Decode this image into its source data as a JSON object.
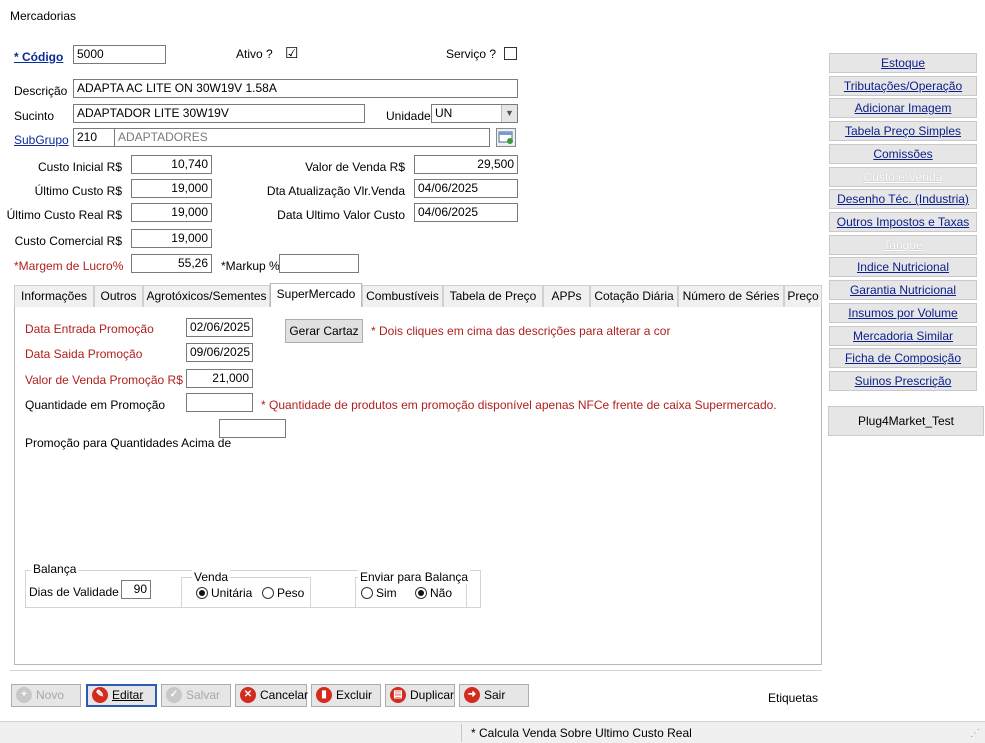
{
  "window": {
    "title": "Mercadorias"
  },
  "form": {
    "codigo_label": "* Código",
    "codigo": "5000",
    "ativo_label": "Ativo ?",
    "ativo_checked": "☑",
    "servico_label": "Serviço ?",
    "descricao_label": "Descrição",
    "descricao": "ADAPTA AC LITE ON 30W19V 1.58A",
    "sucinto_label": "Sucinto",
    "sucinto": "ADAPTADOR LITE 30W19V",
    "unidade_label": "Unidade",
    "unidade": "UN",
    "subgrupo_label": "SubGrupo",
    "subgrupo_code": "210",
    "subgrupo_name": "ADAPTADORES",
    "custo_inicial_label": "Custo Inicial R$",
    "custo_inicial": "10,740",
    "ultimo_custo_label": "Último Custo R$",
    "ultimo_custo": "19,000",
    "ultimo_custo_real_label": "Último Custo Real R$",
    "ultimo_custo_real": "19,000",
    "custo_comercial_label": "Custo Comercial R$",
    "custo_comercial": "19,000",
    "margem_label": "*Margem de Lucro%",
    "margem": "55,26",
    "markup_label": "*Markup %",
    "markup": "",
    "valor_venda_label": "Valor de Venda R$",
    "valor_venda": "29,500",
    "dta_atualizacao_label": "Dta Atualização Vlr.Venda",
    "dta_atualizacao": "04/06/2025",
    "data_ultimo_custo_label": "Data Ultimo Valor Custo",
    "data_ultimo_custo": "04/06/2025"
  },
  "tabs": [
    {
      "label": "Informações"
    },
    {
      "label": "Outros"
    },
    {
      "label": "Agrotóxicos/Sementes"
    },
    {
      "label": "SuperMercado"
    },
    {
      "label": "Combustíveis"
    },
    {
      "label": "Tabela de Preço"
    },
    {
      "label": "APPs"
    },
    {
      "label": "Cotação Diária"
    },
    {
      "label": "Número de Séries"
    },
    {
      "label": "Preço"
    }
  ],
  "supermercado": {
    "data_entrada_label": "Data Entrada Promoção",
    "data_entrada": "02/06/2025",
    "data_saida_label": "Data Saida Promoção",
    "data_saida": "09/06/2025",
    "valor_promo_label": "Valor de Venda  Promoção R$",
    "valor_promo": "21,000",
    "qtd_promo_label": "Quantidade em Promoção",
    "qtd_promo": "",
    "qtd_acima_label": "Promoção para Quantidades Acima de",
    "qtd_acima": "",
    "gerar_cartaz": "Gerar Cartaz",
    "hint_cor": "* Dois cliques em cima das descrições para alterar a cor",
    "hint_qtd": "* Quantidade de produtos em promoção disponível apenas NFCe frente de caixa Supermercado.",
    "balanca_title": "Balança",
    "dias_validade_label": "Dias de Validade",
    "dias_validade": "90",
    "venda_title": "Venda",
    "venda_unitaria": "Unitária",
    "venda_peso": "Peso",
    "enviar_title": "Enviar para Balança",
    "enviar_sim": "Sim",
    "enviar_nao": "Não"
  },
  "sidebar": {
    "items": [
      {
        "label": "Estoque",
        "enabled": true
      },
      {
        "label": "Tributações/Operação",
        "enabled": true
      },
      {
        "label": "Adicionar Imagem",
        "enabled": true
      },
      {
        "label": "Tabela Preço Simples",
        "enabled": true
      },
      {
        "label": "Comissões",
        "enabled": true
      },
      {
        "label": "Custo e Venda",
        "enabled": false
      },
      {
        "label": "Desenho Téc. (Industria)",
        "enabled": true
      },
      {
        "label": "Outros Impostos e Taxas",
        "enabled": true
      },
      {
        "label": "Tanque",
        "enabled": false
      },
      {
        "label": "Indice Nutricional",
        "enabled": true
      },
      {
        "label": "Garantia Nutricional",
        "enabled": true
      },
      {
        "label": "Insumos por Volume",
        "enabled": true
      },
      {
        "label": "Mercadoria Similar",
        "enabled": true
      },
      {
        "label": "Ficha de Composição",
        "enabled": true
      },
      {
        "label": "Suinos Prescrição",
        "enabled": true
      }
    ],
    "plug_label": "Plug4Market_Test"
  },
  "toolbar": {
    "novo": "Novo",
    "editar": "Editar",
    "salvar": "Salvar",
    "cancelar": "Cancelar",
    "excluir": "Excluir",
    "duplicar": "Duplicar",
    "sair": "Sair",
    "etiquetas": "Etiquetas"
  },
  "status": {
    "text": "* Calcula Venda Sobre Ultimo Custo  Real"
  },
  "colors": {
    "required_red": "#b0201e",
    "link_blue": "#0a2a9a",
    "edit_red": "#d42b20"
  }
}
